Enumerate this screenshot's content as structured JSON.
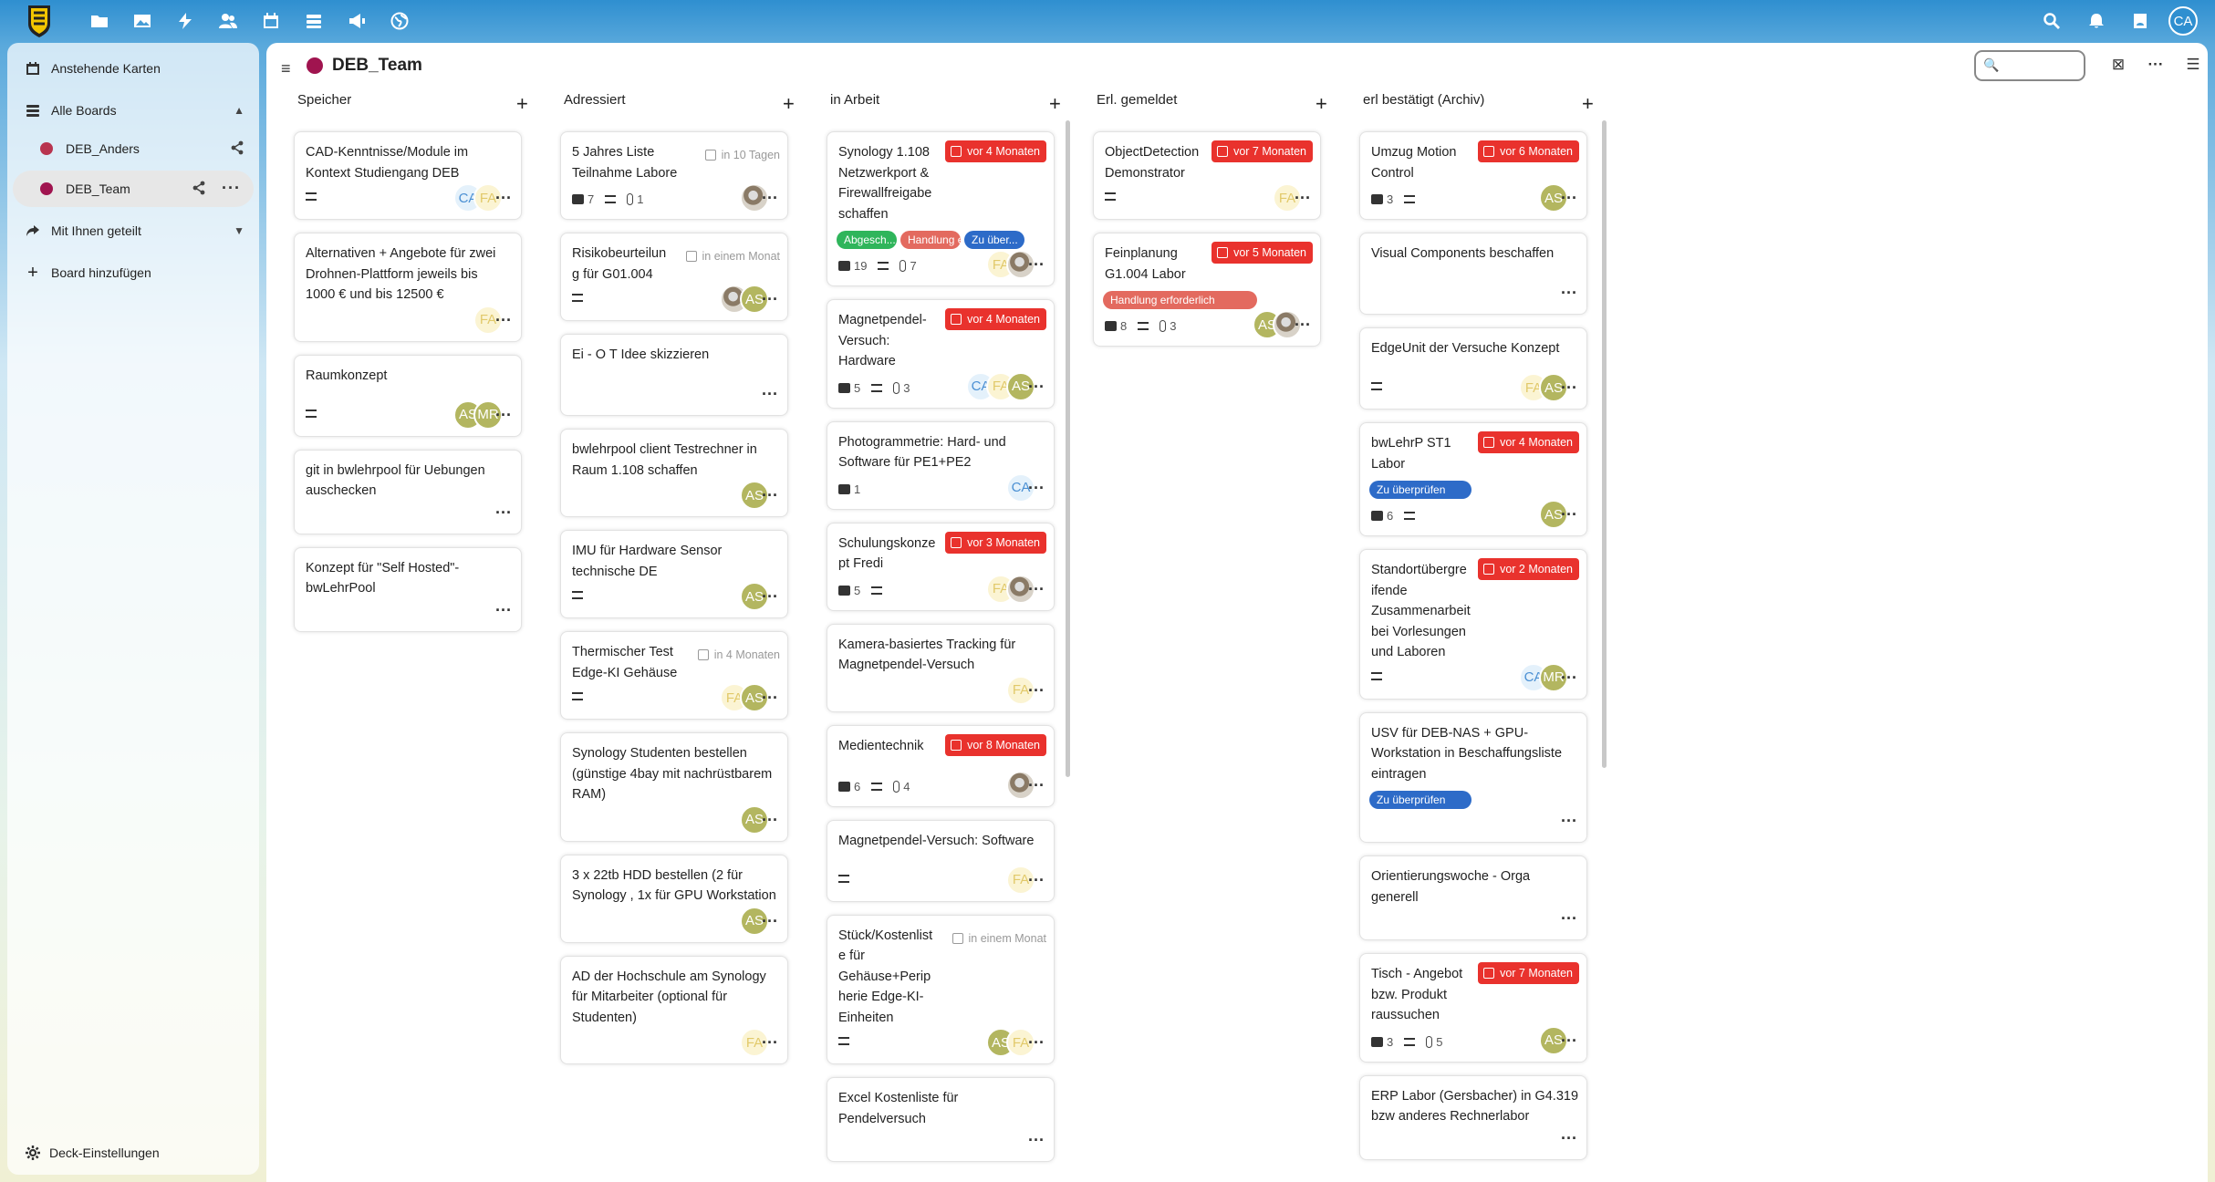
{
  "topbar": {
    "icons": [
      "files-icon",
      "photos-icon",
      "activity-icon",
      "contacts-icon",
      "calendar-icon",
      "deck-icon",
      "announcements-icon",
      "web-icon"
    ],
    "right_icons": [
      "search-icon",
      "notifications-icon",
      "contacts-menu-icon"
    ],
    "avatar": "CA"
  },
  "sidebar": {
    "upcoming": "Anstehende Karten",
    "all_boards": "Alle Boards",
    "boards": [
      {
        "label": "DEB_Anders",
        "color": "#b8344f"
      },
      {
        "label": "DEB_Team",
        "color": "#a0144f"
      }
    ],
    "shared": "Mit Ihnen geteilt",
    "add_board": "Board hinzufügen",
    "settings": "Deck-Einstellungen"
  },
  "board": {
    "title": "DEB_Team",
    "color": "#a0144f"
  },
  "columns": [
    {
      "title": "Speicher",
      "cards": [
        {
          "title": [
            "CAD-Kenntnisse/Module im",
            "Kontext Studiengang DEB"
          ],
          "meta": {
            "desc": true
          },
          "avatars": [
            "CA",
            "FA"
          ]
        },
        {
          "title": [
            "Alternativen + Angebote für zwei",
            "Drohnen-Plattform jeweils bis",
            "1000 € und bis 12500 €"
          ],
          "avatars": [
            "FA"
          ]
        },
        {
          "title": [
            "Raumkonzept"
          ],
          "meta": {
            "desc": true
          },
          "avatars": [
            "AS",
            "MR"
          ]
        },
        {
          "title": [
            "git in bwlehrpool für Uebungen",
            "auschecken"
          ]
        },
        {
          "title": [
            "Konzept für \"Self Hosted\"-",
            "bwLehrPool"
          ]
        }
      ]
    },
    {
      "title": "Adressiert",
      "cards": [
        {
          "title": [
            "5 Jahres Liste",
            "Teilnahme Labore"
          ],
          "due": "in 10 Tagen",
          "meta": {
            "comments": "7",
            "desc": true,
            "attachments": "1"
          },
          "avatars": [
            "photo"
          ]
        },
        {
          "title": [
            "Risikobeurteilun",
            "g für G01.004"
          ],
          "due": "in einem Monat",
          "meta": {
            "desc": true
          },
          "avatars": [
            "photo",
            "AS"
          ]
        },
        {
          "title": [
            "Ei - O T Idee skizzieren"
          ]
        },
        {
          "title": [
            "bwlehrpool client Testrechner in",
            "Raum 1.108 schaffen"
          ],
          "avatars": [
            "AS"
          ]
        },
        {
          "title": [
            "IMU für Hardware Sensor",
            "technische DE"
          ],
          "meta": {
            "desc": true
          },
          "avatars": [
            "AS"
          ]
        },
        {
          "title": [
            "Thermischer Test",
            "Edge-KI Gehäuse"
          ],
          "due": "in 4 Monaten",
          "meta": {
            "desc": true
          },
          "avatars": [
            "FA",
            "AS"
          ]
        },
        {
          "title": [
            "Synology Studenten bestellen",
            "(günstige 4bay mit nachrüstbarem",
            "RAM)"
          ],
          "avatars": [
            "AS"
          ]
        },
        {
          "title": [
            "3 x 22tb HDD bestellen (2 für",
            "Synology , 1x für GPU Workstation"
          ],
          "avatars": [
            "AS"
          ]
        },
        {
          "title": [
            "AD der Hochschule am Synology",
            "für Mitarbeiter (optional für",
            "Studenten)"
          ],
          "avatars": [
            "FA"
          ]
        }
      ]
    },
    {
      "title": "in Arbeit",
      "cards": [
        {
          "title": [
            "Synology 1.108",
            "Netzwerkport &",
            "Firewallfreigabe",
            "schaffen"
          ],
          "due": "vor 4 Monaten",
          "tags": [
            {
              "label": "Abgesch...",
              "color": "#2fb55b"
            },
            {
              "label": "Handlung erf...",
              "color": "#e36a5f"
            },
            {
              "label": "Zu über...",
              "color": "#2d6bc8"
            }
          ],
          "meta": {
            "comments": "19",
            "desc": true,
            "attachments": "7"
          },
          "avatars": [
            "FA",
            "photo"
          ]
        },
        {
          "title": [
            "Magnetpendel-",
            "Versuch:",
            "Hardware"
          ],
          "due": "vor 4 Monaten",
          "meta": {
            "comments": "5",
            "desc": true,
            "attachments": "3"
          },
          "avatars": [
            "CA",
            "FA",
            "AS"
          ]
        },
        {
          "title": [
            "Photogrammetrie: Hard- und",
            "Software für PE1+PE2"
          ],
          "meta": {
            "comments": "1"
          },
          "avatars": [
            "CA"
          ]
        },
        {
          "title": [
            "Schulungskonze",
            "pt Fredi"
          ],
          "due": "vor 3 Monaten",
          "meta": {
            "comments": "5",
            "desc": true
          },
          "avatars": [
            "FA",
            "photo"
          ]
        },
        {
          "title": [
            "Kamera-basiertes Tracking für",
            "Magnetpendel-Versuch"
          ],
          "avatars": [
            "FA"
          ]
        },
        {
          "title": [
            "Medientechnik"
          ],
          "due": "vor 8 Monaten",
          "meta": {
            "comments": "6",
            "desc": true,
            "attachments": "4"
          },
          "avatars": [
            "photo"
          ]
        },
        {
          "title": [
            "Magnetpendel-Versuch: Software"
          ],
          "meta": {
            "desc": true
          },
          "avatars": [
            "FA"
          ]
        },
        {
          "title": [
            "Stück/Kostenlist",
            "e für",
            "Gehäuse+Perip",
            "herie Edge-KI-",
            "Einheiten"
          ],
          "due": "in einem Monat",
          "meta": {
            "desc": true
          },
          "avatars": [
            "AS",
            "FA"
          ]
        },
        {
          "title": [
            "Excel Kostenliste für",
            "Pendelversuch"
          ]
        }
      ]
    },
    {
      "title": "Erl. gemeldet",
      "cards": [
        {
          "title": [
            "ObjectDetection",
            "Demonstrator"
          ],
          "due": "vor 7 Monaten",
          "meta": {
            "desc": true
          },
          "avatars": [
            "FA"
          ]
        },
        {
          "title": [
            "Feinplanung",
            "G1.004 Labor"
          ],
          "due": "vor 5 Monaten",
          "tags": [
            {
              "label": "Handlung erforderlich",
              "color": "#e36a5f"
            }
          ],
          "meta": {
            "comments": "8",
            "desc": true,
            "attachments": "3"
          },
          "avatars": [
            "AS",
            "photo"
          ]
        }
      ]
    },
    {
      "title": "erl bestätigt (Archiv)",
      "cards": [
        {
          "title": [
            "Umzug Motion",
            "Control"
          ],
          "due": "vor 6 Monaten",
          "meta": {
            "comments": "3",
            "desc": true
          },
          "avatars": [
            "AS"
          ]
        },
        {
          "title": [
            "Visual Components beschaffen"
          ]
        },
        {
          "title": [
            "EdgeUnit der Versuche Konzept"
          ],
          "meta": {
            "desc": true
          },
          "avatars": [
            "FA",
            "AS"
          ]
        },
        {
          "title": [
            "bwLehrP ST1",
            "Labor"
          ],
          "due": "vor 4 Monaten",
          "tags": [
            {
              "label": "Zu überprüfen",
              "color": "#2d6bc8"
            }
          ],
          "meta": {
            "comments": "6",
            "desc": true
          },
          "avatars": [
            "AS"
          ]
        },
        {
          "title": [
            "Standortübergre",
            "ifende",
            "Zusammenarbeit",
            "bei Vorlesungen",
            "und Laboren"
          ],
          "due": "vor 2 Monaten",
          "meta": {
            "desc": true
          },
          "avatars": [
            "CA",
            "MR"
          ]
        },
        {
          "title": [
            "USV für DEB-NAS + GPU-",
            "Workstation in Beschaffungsliste",
            "eintragen"
          ],
          "tags": [
            {
              "label": "Zu überprüfen",
              "color": "#2d6bc8"
            }
          ]
        },
        {
          "title": [
            "Orientierungswoche - Orga",
            "generell"
          ]
        },
        {
          "title": [
            "Tisch - Angebot",
            "bzw. Produkt",
            "raussuchen"
          ],
          "due": "vor 7 Monaten",
          "meta": {
            "comments": "3",
            "desc": true,
            "attachments": "5"
          },
          "avatars": [
            "AS"
          ]
        },
        {
          "title": [
            "ERP Labor (Gersbacher) in G4.319",
            "bzw anderes Rechnerlabor"
          ]
        }
      ]
    }
  ]
}
